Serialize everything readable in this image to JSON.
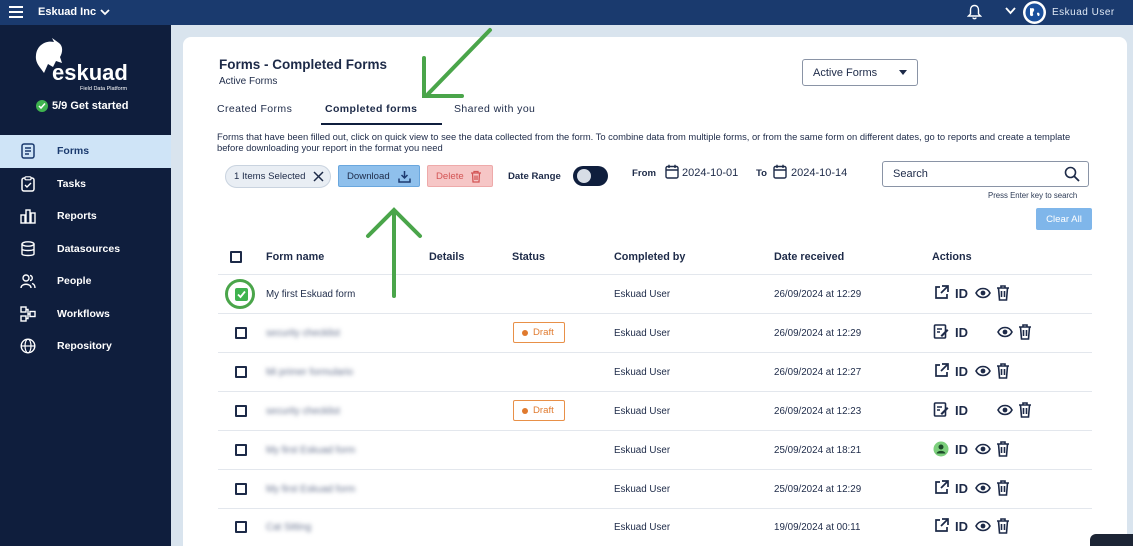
{
  "topbar": {
    "org": "Eskuad Inc",
    "user": "Eskuad User"
  },
  "sidebar": {
    "brand": "eskuad",
    "tagline": "Field Data Platform",
    "get_started": "5/9 Get started",
    "items": [
      {
        "label": "Forms",
        "icon": "file-icon"
      },
      {
        "label": "Tasks",
        "icon": "clipboard-icon"
      },
      {
        "label": "Reports",
        "icon": "bar-chart-icon"
      },
      {
        "label": "Datasources",
        "icon": "database-icon"
      },
      {
        "label": "People",
        "icon": "people-icon"
      },
      {
        "label": "Workflows",
        "icon": "workflow-icon"
      },
      {
        "label": "Repository",
        "icon": "globe-icon"
      }
    ]
  },
  "header": {
    "title": "Forms - Completed Forms",
    "subtitle": "Active Forms",
    "filter_select": "Active Forms"
  },
  "tabs": [
    "Created Forms",
    "Completed forms",
    "Shared with you"
  ],
  "description": "Forms that have been filled out, click on quick view to see the data collected from the form. To combine data from multiple forms, or from the same form on different dates, go to reports and create a template before downloading your report in the format you need",
  "toolbar": {
    "selected_chip": "1 Items Selected",
    "download": "Download",
    "delete": "Delete",
    "date_range": "Date Range",
    "from_label": "From",
    "from_value": "2024-10-01",
    "to_label": "To",
    "to_value": "2024-10-14",
    "search_placeholder": "Search",
    "search_hint": "Press Enter key to search",
    "clear_all": "Clear All"
  },
  "table": {
    "headers": [
      "Form name",
      "Details",
      "Status",
      "Completed by",
      "Date received",
      "Actions"
    ],
    "rows": [
      {
        "name": "My first Eskuad form",
        "status": "",
        "by": "Eskuad User",
        "date": "26/09/2024 at 12:29",
        "checked": true,
        "action": "share"
      },
      {
        "name": "security checklist",
        "status": "Draft",
        "by": "Eskuad User",
        "date": "26/09/2024 at 12:29",
        "checked": false,
        "action": "edit"
      },
      {
        "name": "Mi primer formulario",
        "status": "",
        "by": "Eskuad User",
        "date": "26/09/2024 at 12:27",
        "checked": false,
        "action": "share"
      },
      {
        "name": "security checklist",
        "status": "Draft",
        "by": "Eskuad User",
        "date": "26/09/2024 at 12:23",
        "checked": false,
        "action": "edit"
      },
      {
        "name": "My first Eskuad form",
        "status": "",
        "by": "Eskuad User",
        "date": "25/09/2024 at 18:21",
        "checked": false,
        "action": "user"
      },
      {
        "name": "My first Eskuad form",
        "status": "",
        "by": "Eskuad User",
        "date": "25/09/2024 at 12:29",
        "checked": false,
        "action": "share"
      },
      {
        "name": "Cat Sitting",
        "status": "",
        "by": "Eskuad User",
        "date": "19/09/2024 at 00:11",
        "checked": false,
        "action": "share"
      }
    ],
    "id_label": "ID"
  },
  "colors": {
    "primary": "#1a3a6e",
    "sidebar": "#0f1e3d",
    "annotation": "#4aa54a",
    "draft": "#e07a2e"
  }
}
